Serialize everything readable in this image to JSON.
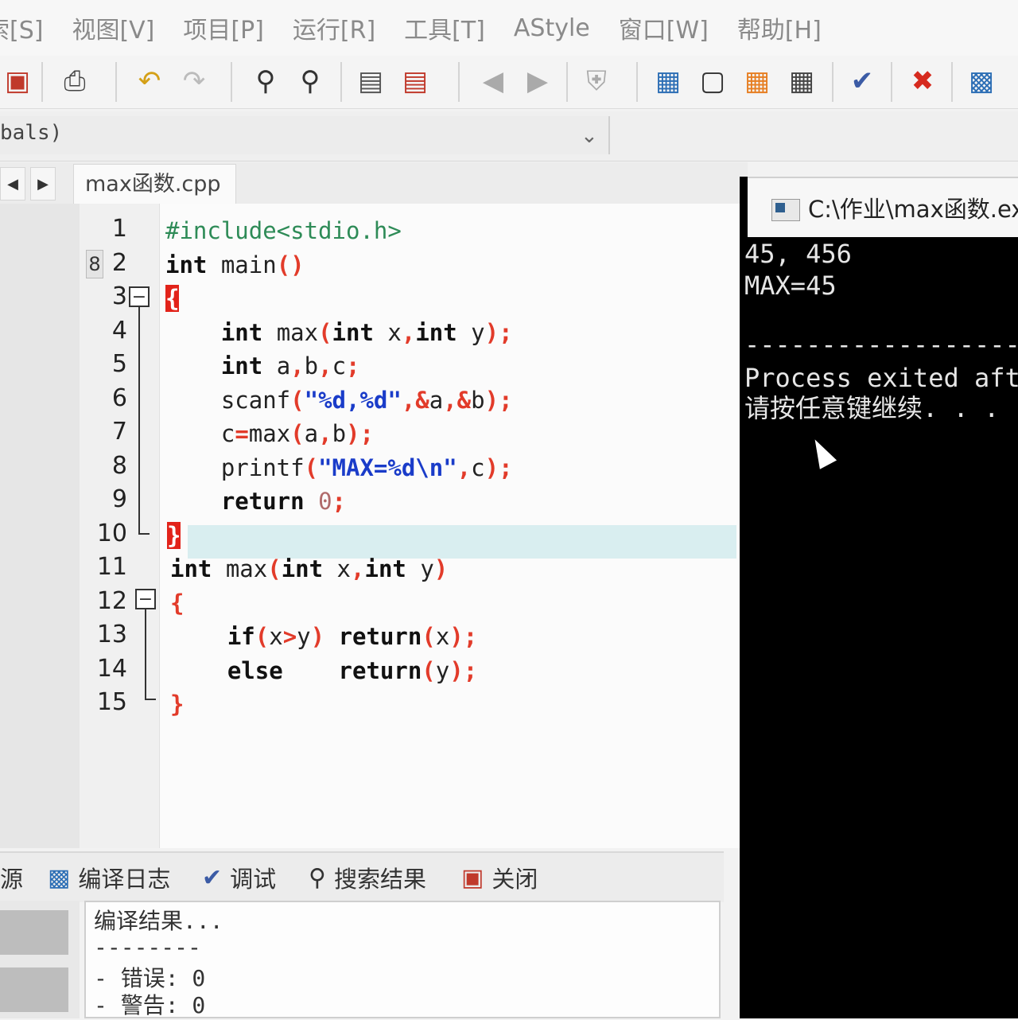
{
  "menu": [
    "索[S]",
    "视图[V]",
    "项目[P]",
    "运行[R]",
    "工具[T]",
    "AStyle",
    "窗口[W]",
    "帮助[H]"
  ],
  "scope": {
    "text": "bals)"
  },
  "tab": {
    "filename": "max函数.cpp"
  },
  "editor": {
    "line_numbers": [
      "1",
      "2",
      "3",
      "4",
      "5",
      "6",
      "7",
      "8",
      "9",
      "10",
      "11",
      "12",
      "13",
      "14",
      "15"
    ],
    "bookmark_marker": "8",
    "lines": [
      [
        {
          "t": "#include<stdio.h>",
          "c": "pre"
        }
      ],
      [
        {
          "t": "int",
          "c": "kw"
        },
        {
          "t": " main",
          "c": ""
        },
        {
          "t": "()",
          "c": "op"
        }
      ],
      [
        {
          "t": "{",
          "c": "brace-red"
        }
      ],
      [
        {
          "t": "    ",
          "c": ""
        },
        {
          "t": "int",
          "c": "kw"
        },
        {
          "t": " max",
          "c": ""
        },
        {
          "t": "(",
          "c": "op"
        },
        {
          "t": "int",
          "c": "kw"
        },
        {
          "t": " x",
          "c": ""
        },
        {
          "t": ",",
          "c": "op"
        },
        {
          "t": "int",
          "c": "kw"
        },
        {
          "t": " y",
          "c": ""
        },
        {
          "t": ");",
          "c": "op"
        }
      ],
      [
        {
          "t": "    ",
          "c": ""
        },
        {
          "t": "int",
          "c": "kw"
        },
        {
          "t": " a",
          "c": ""
        },
        {
          "t": ",",
          "c": "op"
        },
        {
          "t": "b",
          "c": ""
        },
        {
          "t": ",",
          "c": "op"
        },
        {
          "t": "c",
          "c": ""
        },
        {
          "t": ";",
          "c": "op"
        }
      ],
      [
        {
          "t": "    scanf",
          "c": ""
        },
        {
          "t": "(",
          "c": "op"
        },
        {
          "t": "\"%d,%d\"",
          "c": "str"
        },
        {
          "t": ",&",
          "c": "op"
        },
        {
          "t": "a",
          "c": ""
        },
        {
          "t": ",&",
          "c": "op"
        },
        {
          "t": "b",
          "c": ""
        },
        {
          "t": ");",
          "c": "op"
        }
      ],
      [
        {
          "t": "    c",
          "c": ""
        },
        {
          "t": "=",
          "c": "op"
        },
        {
          "t": "max",
          "c": ""
        },
        {
          "t": "(",
          "c": "op"
        },
        {
          "t": "a",
          "c": ""
        },
        {
          "t": ",",
          "c": "op"
        },
        {
          "t": "b",
          "c": ""
        },
        {
          "t": ");",
          "c": "op"
        }
      ],
      [
        {
          "t": "    printf",
          "c": ""
        },
        {
          "t": "(",
          "c": "op"
        },
        {
          "t": "\"MAX=%d\\n\"",
          "c": "str"
        },
        {
          "t": ",",
          "c": "op"
        },
        {
          "t": "c",
          "c": ""
        },
        {
          "t": ");",
          "c": "op"
        }
      ],
      [
        {
          "t": "    ",
          "c": ""
        },
        {
          "t": "return",
          "c": "kw"
        },
        {
          "t": " ",
          "c": ""
        },
        {
          "t": "0",
          "c": "num"
        },
        {
          "t": ";",
          "c": "op"
        }
      ],
      [
        {
          "t": "}",
          "c": "brace-red"
        }
      ],
      [
        {
          "t": "int",
          "c": "kw"
        },
        {
          "t": " max",
          "c": ""
        },
        {
          "t": "(",
          "c": "op"
        },
        {
          "t": "int",
          "c": "kw"
        },
        {
          "t": " x",
          "c": ""
        },
        {
          "t": ",",
          "c": "op"
        },
        {
          "t": "int",
          "c": "kw"
        },
        {
          "t": " y",
          "c": ""
        },
        {
          "t": ")",
          "c": "op"
        }
      ],
      [
        {
          "t": "{",
          "c": "op"
        }
      ],
      [
        {
          "t": "    ",
          "c": ""
        },
        {
          "t": "if",
          "c": "kw"
        },
        {
          "t": "(",
          "c": "op"
        },
        {
          "t": "x",
          "c": ""
        },
        {
          "t": ">",
          "c": "op"
        },
        {
          "t": "y",
          "c": ""
        },
        {
          "t": ")",
          "c": "op"
        },
        {
          "t": " ",
          "c": ""
        },
        {
          "t": "return",
          "c": "kw"
        },
        {
          "t": "(",
          "c": "op"
        },
        {
          "t": "x",
          "c": ""
        },
        {
          "t": ");",
          "c": "op"
        }
      ],
      [
        {
          "t": "    ",
          "c": ""
        },
        {
          "t": "else",
          "c": "kw"
        },
        {
          "t": "    ",
          "c": ""
        },
        {
          "t": "return",
          "c": "kw"
        },
        {
          "t": "(",
          "c": "op"
        },
        {
          "t": "y",
          "c": ""
        },
        {
          "t": ");",
          "c": "op"
        }
      ],
      [
        {
          "t": "}",
          "c": "op"
        }
      ]
    ]
  },
  "console": {
    "title": "C:\\作业\\max函数.exe",
    "lines": [
      "45, 456",
      "MAX=45",
      "",
      "-------------------",
      "Process exited afte",
      "请按任意键继续. . ."
    ]
  },
  "bottom_tabs": [
    {
      "icon": "",
      "label": "源",
      "name": "tab-resources"
    },
    {
      "icon": "bar-chart-icon",
      "label": "编译日志",
      "name": "tab-compile-log"
    },
    {
      "icon": "checkmark-icon",
      "label": "调试",
      "name": "tab-debug"
    },
    {
      "icon": "search-document-icon",
      "label": "搜索结果",
      "name": "tab-search-results"
    },
    {
      "icon": "close-window-icon",
      "label": "关闭",
      "name": "tab-close"
    }
  ],
  "compile_log": [
    "编译结果...",
    "--------",
    "- 错误: 0",
    "- 警告: 0"
  ]
}
